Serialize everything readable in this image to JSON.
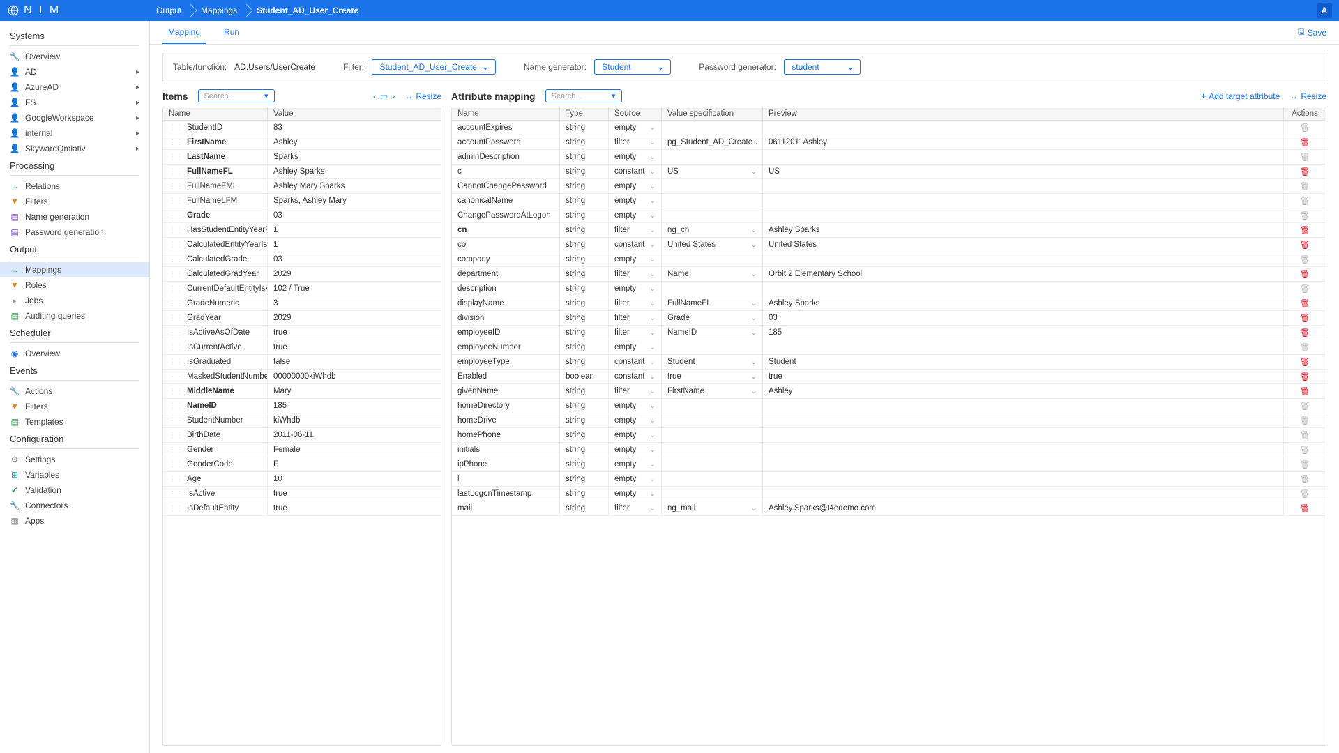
{
  "topbar": {
    "logo_text": "N I M",
    "breadcrumbs": [
      "Output",
      "Mappings",
      "Student_AD_User_Create"
    ],
    "user_initial": "A"
  },
  "sidebar": {
    "sections": [
      {
        "title": "Systems",
        "items": [
          {
            "icon": "wrench",
            "cls": "ic-blue",
            "label": "Overview",
            "exp": false
          },
          {
            "icon": "person",
            "cls": "ic-blue",
            "label": "AD",
            "exp": true
          },
          {
            "icon": "person",
            "cls": "ic-blue",
            "label": "AzureAD",
            "exp": true
          },
          {
            "icon": "person",
            "cls": "ic-blue",
            "label": "FS",
            "exp": true
          },
          {
            "icon": "person",
            "cls": "ic-blue",
            "label": "GoogleWorkspace",
            "exp": true
          },
          {
            "icon": "person",
            "cls": "ic-blue",
            "label": "internal",
            "exp": true
          },
          {
            "icon": "person",
            "cls": "ic-blue",
            "label": "SkywardQmlativ",
            "exp": true
          }
        ]
      },
      {
        "title": "Processing",
        "items": [
          {
            "icon": "link",
            "cls": "ic-teal",
            "label": "Relations"
          },
          {
            "icon": "filter",
            "cls": "ic-orange",
            "label": "Filters"
          },
          {
            "icon": "doc",
            "cls": "ic-purple",
            "label": "Name generation"
          },
          {
            "icon": "doc",
            "cls": "ic-purple",
            "label": "Password generation"
          }
        ]
      },
      {
        "title": "Output",
        "items": [
          {
            "icon": "link",
            "cls": "ic-teal",
            "label": "Mappings",
            "active": true
          },
          {
            "icon": "filter",
            "cls": "ic-orange",
            "label": "Roles"
          },
          {
            "icon": "job",
            "cls": "ic-grey",
            "label": "Jobs"
          },
          {
            "icon": "doc",
            "cls": "ic-green",
            "label": "Auditing queries"
          }
        ]
      },
      {
        "title": "Scheduler",
        "items": [
          {
            "icon": "globe",
            "cls": "ic-blue",
            "label": "Overview"
          }
        ]
      },
      {
        "title": "Events",
        "items": [
          {
            "icon": "wrench",
            "cls": "ic-blue",
            "label": "Actions"
          },
          {
            "icon": "filter",
            "cls": "ic-orange",
            "label": "Filters"
          },
          {
            "icon": "doc",
            "cls": "ic-green",
            "label": "Templates"
          }
        ]
      },
      {
        "title": "Configuration",
        "items": [
          {
            "icon": "gear",
            "cls": "ic-grey",
            "label": "Settings"
          },
          {
            "icon": "var",
            "cls": "ic-teal",
            "label": "Variables"
          },
          {
            "icon": "check",
            "cls": "ic-green",
            "label": "Validation"
          },
          {
            "icon": "wrench",
            "cls": "ic-blue",
            "label": "Connectors"
          },
          {
            "icon": "app",
            "cls": "ic-grey",
            "label": "Apps"
          }
        ]
      }
    ]
  },
  "tabs": {
    "items": [
      "Mapping",
      "Run"
    ],
    "active": 0,
    "save_label": "Save"
  },
  "config": {
    "table_label": "Table/function:",
    "table_value": "AD.Users/UserCreate",
    "filter_label": "Filter:",
    "filter_value": "Student_AD_User_Create",
    "namegen_label": "Name generator:",
    "namegen_value": "Student",
    "pwgen_label": "Password generator:",
    "pwgen_value": "student"
  },
  "items_panel": {
    "title": "Items",
    "search_placeholder": "Search...",
    "resize_label": "Resize",
    "columns": [
      "Name",
      "Value"
    ],
    "rows": [
      {
        "name": "StudentID",
        "value": "83"
      },
      {
        "name": "FirstName",
        "value": "Ashley",
        "bold": true
      },
      {
        "name": "LastName",
        "value": "Sparks",
        "bold": true
      },
      {
        "name": "FullNameFL",
        "value": "Ashley Sparks",
        "bold": true
      },
      {
        "name": "FullNameFML",
        "value": "Ashley Mary Sparks"
      },
      {
        "name": "FullNameLFM",
        "value": "Sparks, Ashley Mary"
      },
      {
        "name": "Grade",
        "value": "03",
        "bold": true
      },
      {
        "name": "HasStudentEntityYearForC...",
        "value": "1"
      },
      {
        "name": "CalculatedEntityYearIsActive",
        "value": "1"
      },
      {
        "name": "CalculatedGrade",
        "value": "03"
      },
      {
        "name": "CalculatedGradYear",
        "value": "2029"
      },
      {
        "name": "CurrentDefaultEntityIsActi...",
        "value": "102 / True"
      },
      {
        "name": "GradeNumeric",
        "value": "3"
      },
      {
        "name": "GradYear",
        "value": "2029"
      },
      {
        "name": "IsActiveAsOfDate",
        "value": "true"
      },
      {
        "name": "IsCurrentActive",
        "value": "true"
      },
      {
        "name": "IsGraduated",
        "value": "false"
      },
      {
        "name": "MaskedStudentNumber",
        "value": "00000000kiWhdb"
      },
      {
        "name": "MiddleName",
        "value": "Mary",
        "bold": true
      },
      {
        "name": "NameID",
        "value": "185",
        "bold": true
      },
      {
        "name": "StudentNumber",
        "value": "kiWhdb"
      },
      {
        "name": "BirthDate",
        "value": "2011-06-11"
      },
      {
        "name": "Gender",
        "value": "Female"
      },
      {
        "name": "GenderCode",
        "value": "F"
      },
      {
        "name": "Age",
        "value": "10"
      },
      {
        "name": "IsActive",
        "value": "true"
      },
      {
        "name": "IsDefaultEntity",
        "value": "true"
      }
    ]
  },
  "attrs_panel": {
    "title": "Attribute mapping",
    "search_placeholder": "Search...",
    "add_label": "Add target attribute",
    "resize_label": "Resize",
    "columns": [
      "Name",
      "Type",
      "Source",
      "Value specification",
      "Preview",
      "Actions"
    ],
    "rows": [
      {
        "name": "accountExpires",
        "type": "string",
        "src": "empty",
        "spec": "",
        "prev": "",
        "del": "grey"
      },
      {
        "name": "accountPassword",
        "type": "string",
        "src": "filter",
        "spec": "pg_Student_AD_Create",
        "prev": "06112011Ashley",
        "del": "red"
      },
      {
        "name": "adminDescription",
        "type": "string",
        "src": "empty",
        "spec": "",
        "prev": "",
        "del": "grey"
      },
      {
        "name": "c",
        "type": "string",
        "src": "constant",
        "spec": "US",
        "prev": "US",
        "del": "red"
      },
      {
        "name": "CannotChangePassword",
        "type": "string",
        "src": "empty",
        "spec": "",
        "prev": "",
        "del": "grey"
      },
      {
        "name": "canonicalName",
        "type": "string",
        "src": "empty",
        "spec": "",
        "prev": "",
        "del": "grey"
      },
      {
        "name": "ChangePasswordAtLogon",
        "type": "string",
        "src": "empty",
        "spec": "",
        "prev": "",
        "del": "grey"
      },
      {
        "name": "cn",
        "type": "string",
        "src": "filter",
        "spec": "ng_cn",
        "prev": "Ashley Sparks",
        "del": "red",
        "bold": true
      },
      {
        "name": "co",
        "type": "string",
        "src": "constant",
        "spec": "United States",
        "prev": "United States",
        "del": "red"
      },
      {
        "name": "company",
        "type": "string",
        "src": "empty",
        "spec": "",
        "prev": "",
        "del": "grey"
      },
      {
        "name": "department",
        "type": "string",
        "src": "filter",
        "spec": "Name",
        "prev": "Orbit 2 Elementary School",
        "del": "red"
      },
      {
        "name": "description",
        "type": "string",
        "src": "empty",
        "spec": "",
        "prev": "",
        "del": "grey"
      },
      {
        "name": "displayName",
        "type": "string",
        "src": "filter",
        "spec": "FullNameFL",
        "prev": "Ashley Sparks",
        "del": "red"
      },
      {
        "name": "division",
        "type": "string",
        "src": "filter",
        "spec": "Grade",
        "prev": "03",
        "del": "red"
      },
      {
        "name": "employeeID",
        "type": "string",
        "src": "filter",
        "spec": "NameID",
        "prev": "185",
        "del": "red"
      },
      {
        "name": "employeeNumber",
        "type": "string",
        "src": "empty",
        "spec": "",
        "prev": "",
        "del": "grey"
      },
      {
        "name": "employeeType",
        "type": "string",
        "src": "constant",
        "spec": "Student",
        "prev": "Student",
        "del": "red"
      },
      {
        "name": "Enabled",
        "type": "boolean",
        "src": "constant",
        "spec": "true",
        "prev": "true",
        "del": "red"
      },
      {
        "name": "givenName",
        "type": "string",
        "src": "filter",
        "spec": "FirstName",
        "prev": "Ashley",
        "del": "red"
      },
      {
        "name": "homeDirectory",
        "type": "string",
        "src": "empty",
        "spec": "",
        "prev": "",
        "del": "grey"
      },
      {
        "name": "homeDrive",
        "type": "string",
        "src": "empty",
        "spec": "",
        "prev": "",
        "del": "grey"
      },
      {
        "name": "homePhone",
        "type": "string",
        "src": "empty",
        "spec": "",
        "prev": "",
        "del": "grey"
      },
      {
        "name": "initials",
        "type": "string",
        "src": "empty",
        "spec": "",
        "prev": "",
        "del": "grey"
      },
      {
        "name": "ipPhone",
        "type": "string",
        "src": "empty",
        "spec": "",
        "prev": "",
        "del": "grey"
      },
      {
        "name": "l",
        "type": "string",
        "src": "empty",
        "spec": "",
        "prev": "",
        "del": "grey"
      },
      {
        "name": "lastLogonTimestamp",
        "type": "string",
        "src": "empty",
        "spec": "",
        "prev": "",
        "del": "grey"
      },
      {
        "name": "mail",
        "type": "string",
        "src": "filter",
        "spec": "ng_mail",
        "prev": "Ashley.Sparks@t4edemo.com",
        "del": "red"
      }
    ]
  }
}
